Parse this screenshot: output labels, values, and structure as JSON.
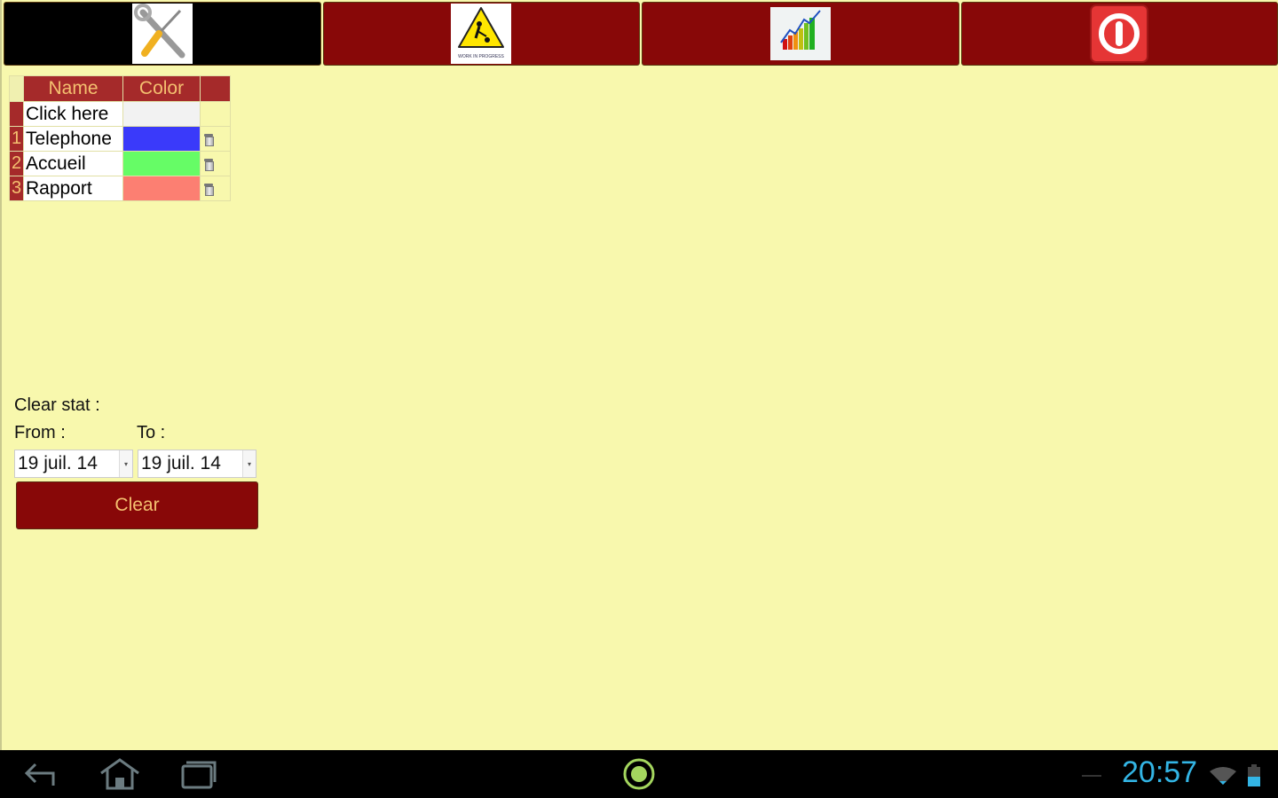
{
  "toolbar": {
    "buttons": [
      {
        "name": "settings",
        "icon": "tools-icon",
        "active": true
      },
      {
        "name": "work-in-progress",
        "icon": "work-in-progress-icon",
        "caption": "WORK IN PROGRESS"
      },
      {
        "name": "statistics",
        "icon": "growth-chart-icon"
      },
      {
        "name": "power",
        "icon": "power-icon"
      }
    ]
  },
  "table": {
    "headers": {
      "name": "Name",
      "color": "Color"
    },
    "add_row": {
      "name": "Click here",
      "color": "#f2f2f2"
    },
    "rows": [
      {
        "num": "1",
        "name": "Telephone",
        "color": "#3a3afa"
      },
      {
        "num": "2",
        "name": "Accueil",
        "color": "#66fc66"
      },
      {
        "num": "3",
        "name": "Rapport",
        "color": "#fc7f72"
      }
    ]
  },
  "clear_stat": {
    "title": "Clear stat :",
    "from_label": "From :",
    "to_label": "To :",
    "from_value": "19 juil. 14",
    "to_value": "19 juil. 14",
    "clear_label": "Clear"
  },
  "system_bar": {
    "time": "20:57"
  }
}
